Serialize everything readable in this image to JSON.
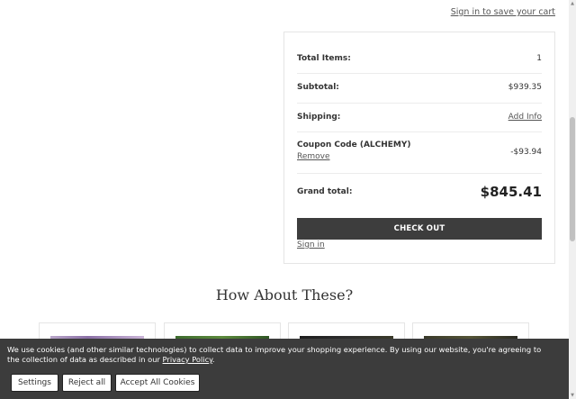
{
  "header": {
    "sign_in_save": "Sign in to save your cart"
  },
  "summary": {
    "total_items_label": "Total Items:",
    "total_items_value": "1",
    "subtotal_label": "Subtotal:",
    "subtotal_value": "$939.35",
    "shipping_label": "Shipping:",
    "shipping_link": "Add Info",
    "coupon_label": "Coupon Code (ALCHEMY)",
    "coupon_remove": "Remove",
    "coupon_value": "-$93.94",
    "grand_total_label": "Grand total:",
    "grand_total_value": "$845.41",
    "checkout_label": "CHECK OUT",
    "sign_in": "Sign in"
  },
  "recommendations": {
    "title": "How About These?"
  },
  "cookie": {
    "text": "We use cookies (and other similar technologies) to collect data to improve your shopping experience. By using our website, you're agreeing to the collection of data as described in our",
    "privacy_link": "Privacy Policy",
    "settings": "Settings",
    "reject": "Reject all",
    "accept": "Accept All Cookies"
  },
  "colors": {
    "button_dark": "#3d3d3d",
    "banner_bg": "#3c3c3c"
  }
}
